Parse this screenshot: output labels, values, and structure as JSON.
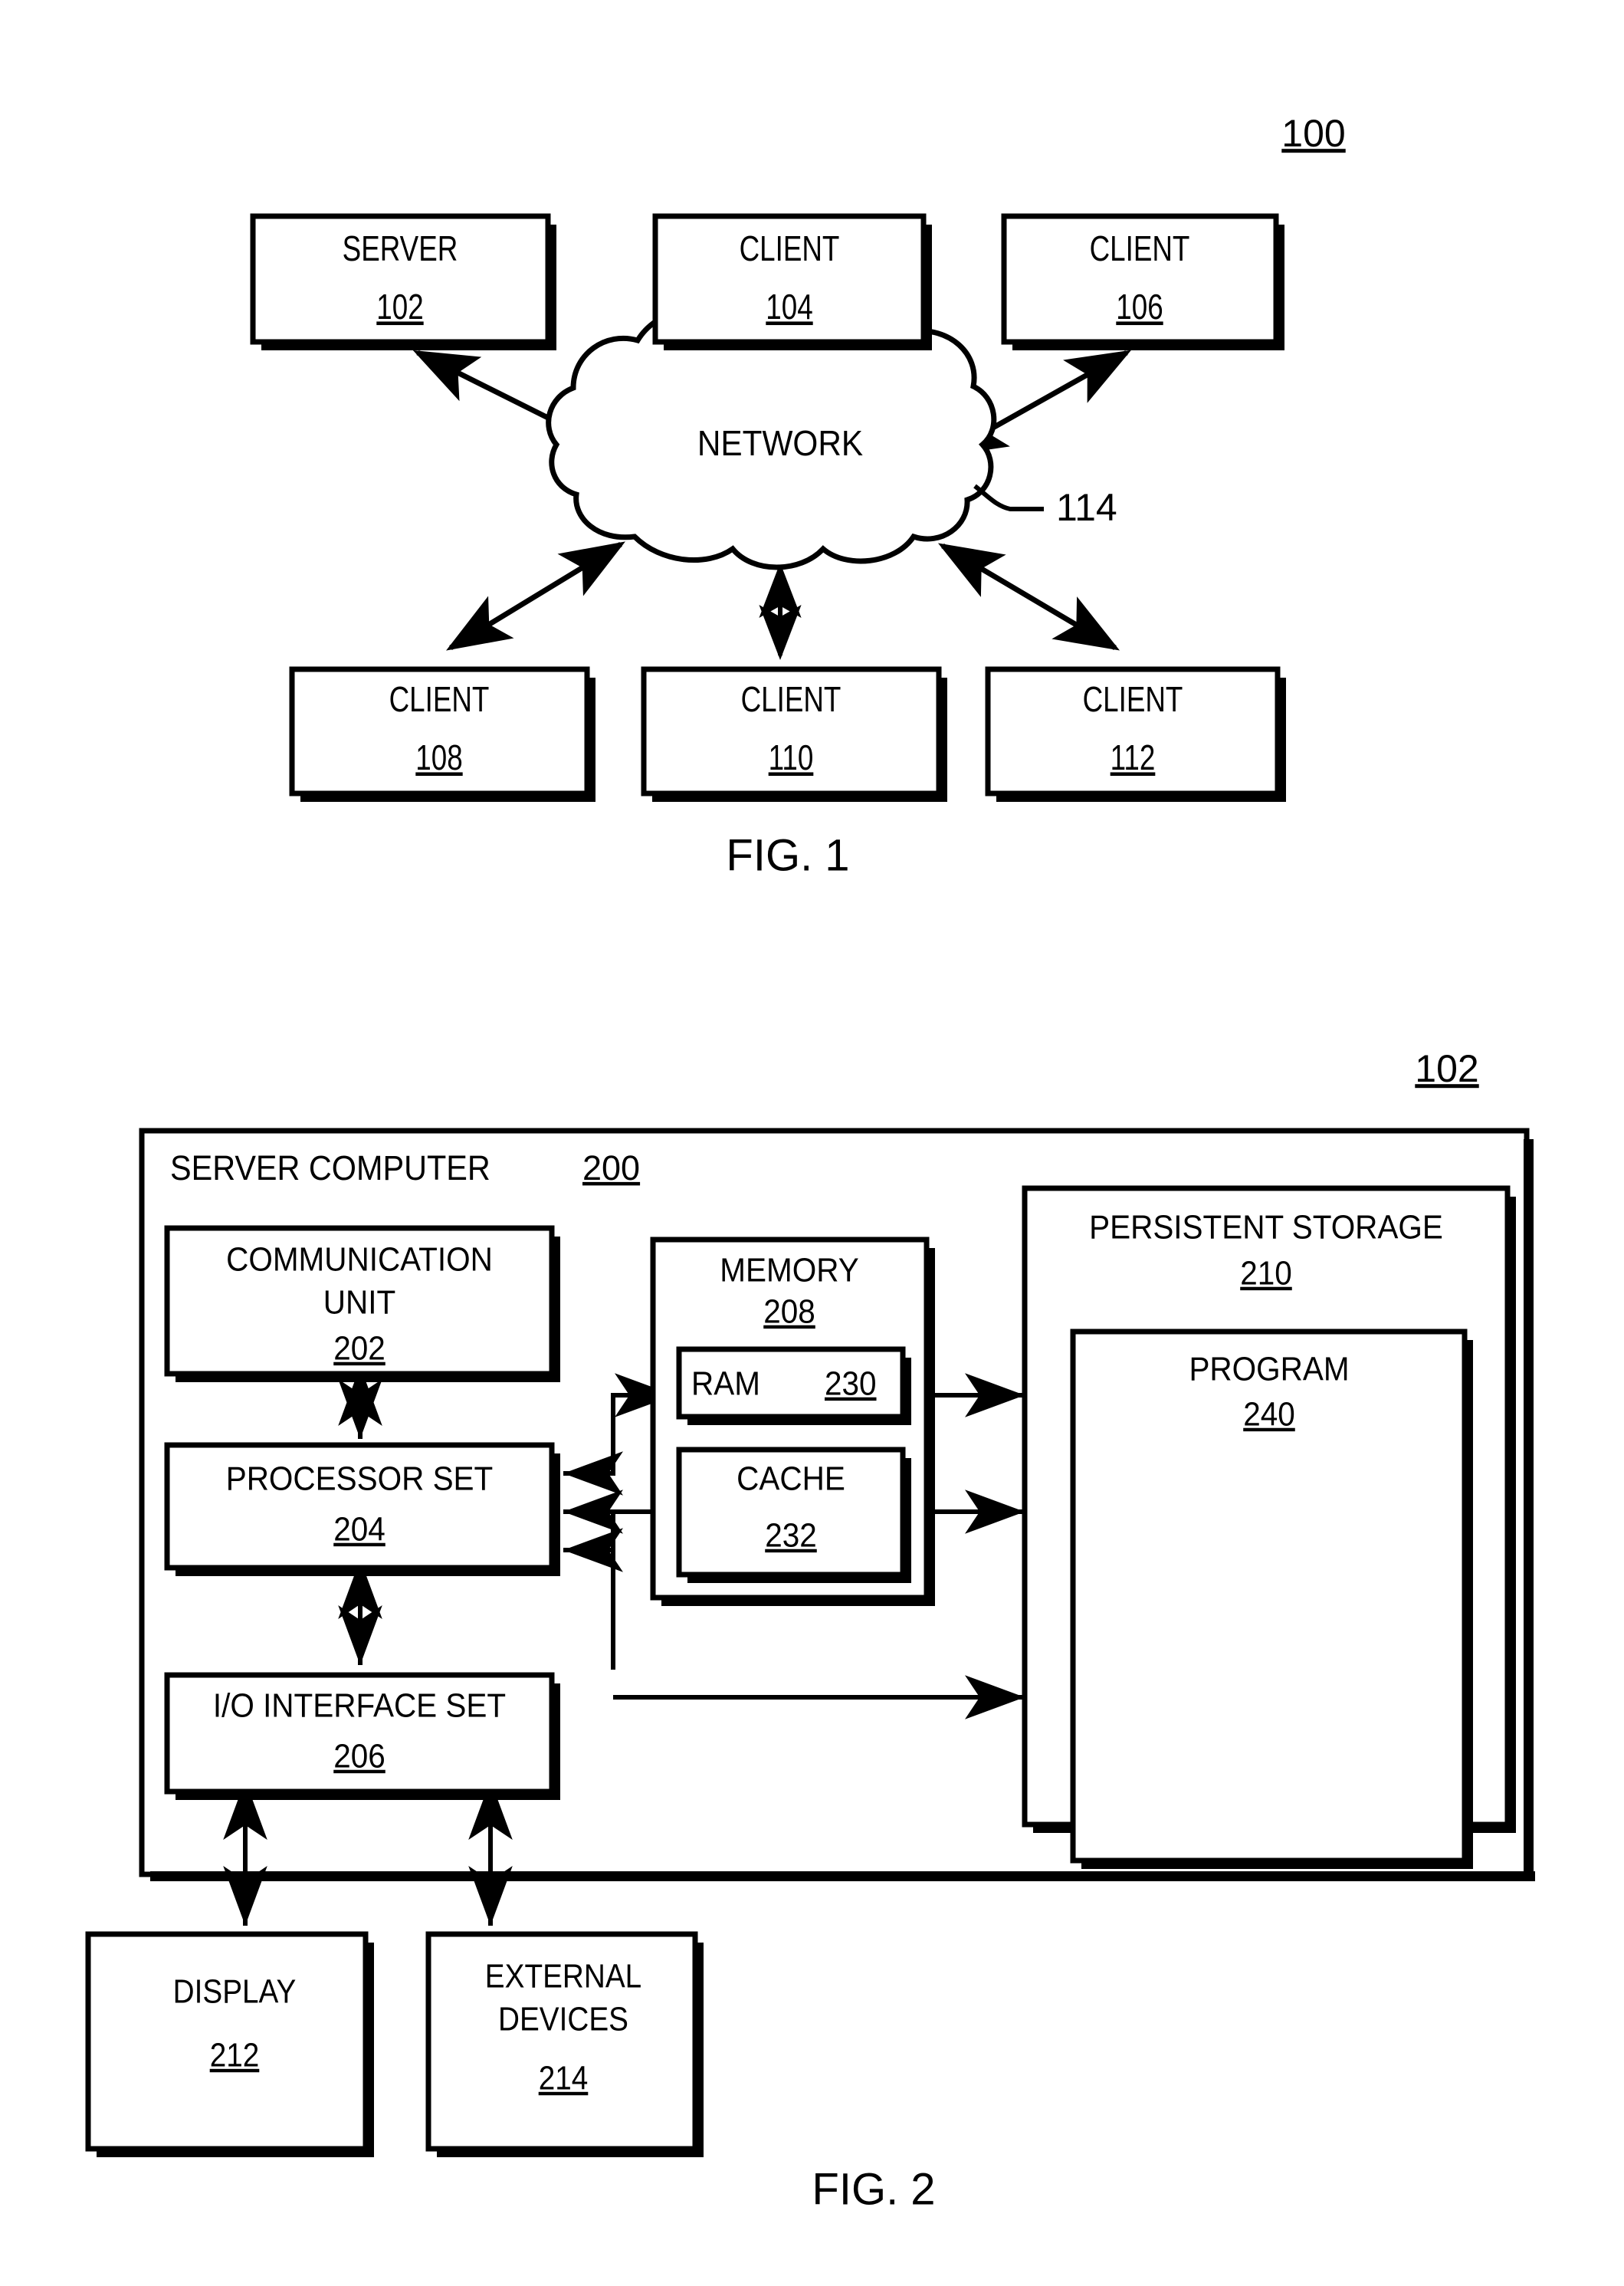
{
  "figure1": {
    "ref_number": "100",
    "caption": "FIG. 1",
    "network": {
      "label": "NETWORK",
      "ref": "114"
    },
    "top_nodes": [
      {
        "label": "SERVER",
        "ref": "102"
      },
      {
        "label": "CLIENT",
        "ref": "104"
      },
      {
        "label": "CLIENT",
        "ref": "106"
      }
    ],
    "bottom_nodes": [
      {
        "label": "CLIENT",
        "ref": "108"
      },
      {
        "label": "CLIENT",
        "ref": "110"
      },
      {
        "label": "CLIENT",
        "ref": "112"
      }
    ]
  },
  "figure2": {
    "ref_number": "102",
    "caption": "FIG. 2",
    "container": {
      "label": "SERVER COMPUTER",
      "ref": "200"
    },
    "blocks": {
      "communication_unit": {
        "line1": "COMMUNICATION",
        "line2": "UNIT",
        "ref": "202"
      },
      "processor_set": {
        "line1": "PROCESSOR SET",
        "ref": "204"
      },
      "io_interface_set": {
        "line1": "I/O INTERFACE SET",
        "ref": "206"
      },
      "memory": {
        "line1": "MEMORY",
        "ref": "208"
      },
      "ram": {
        "line1": "RAM",
        "ref": "230"
      },
      "cache": {
        "line1": "CACHE",
        "ref": "232"
      },
      "persistent_storage": {
        "line1": "PERSISTENT STORAGE",
        "ref": "210"
      },
      "program": {
        "line1": "PROGRAM",
        "ref": "240"
      },
      "display": {
        "line1": "DISPLAY",
        "ref": "212"
      },
      "external_devices": {
        "line1": "EXTERNAL",
        "line2": "DEVICES",
        "ref": "214"
      }
    }
  },
  "colors": {
    "ink": "#000000",
    "paper": "#ffffff"
  }
}
